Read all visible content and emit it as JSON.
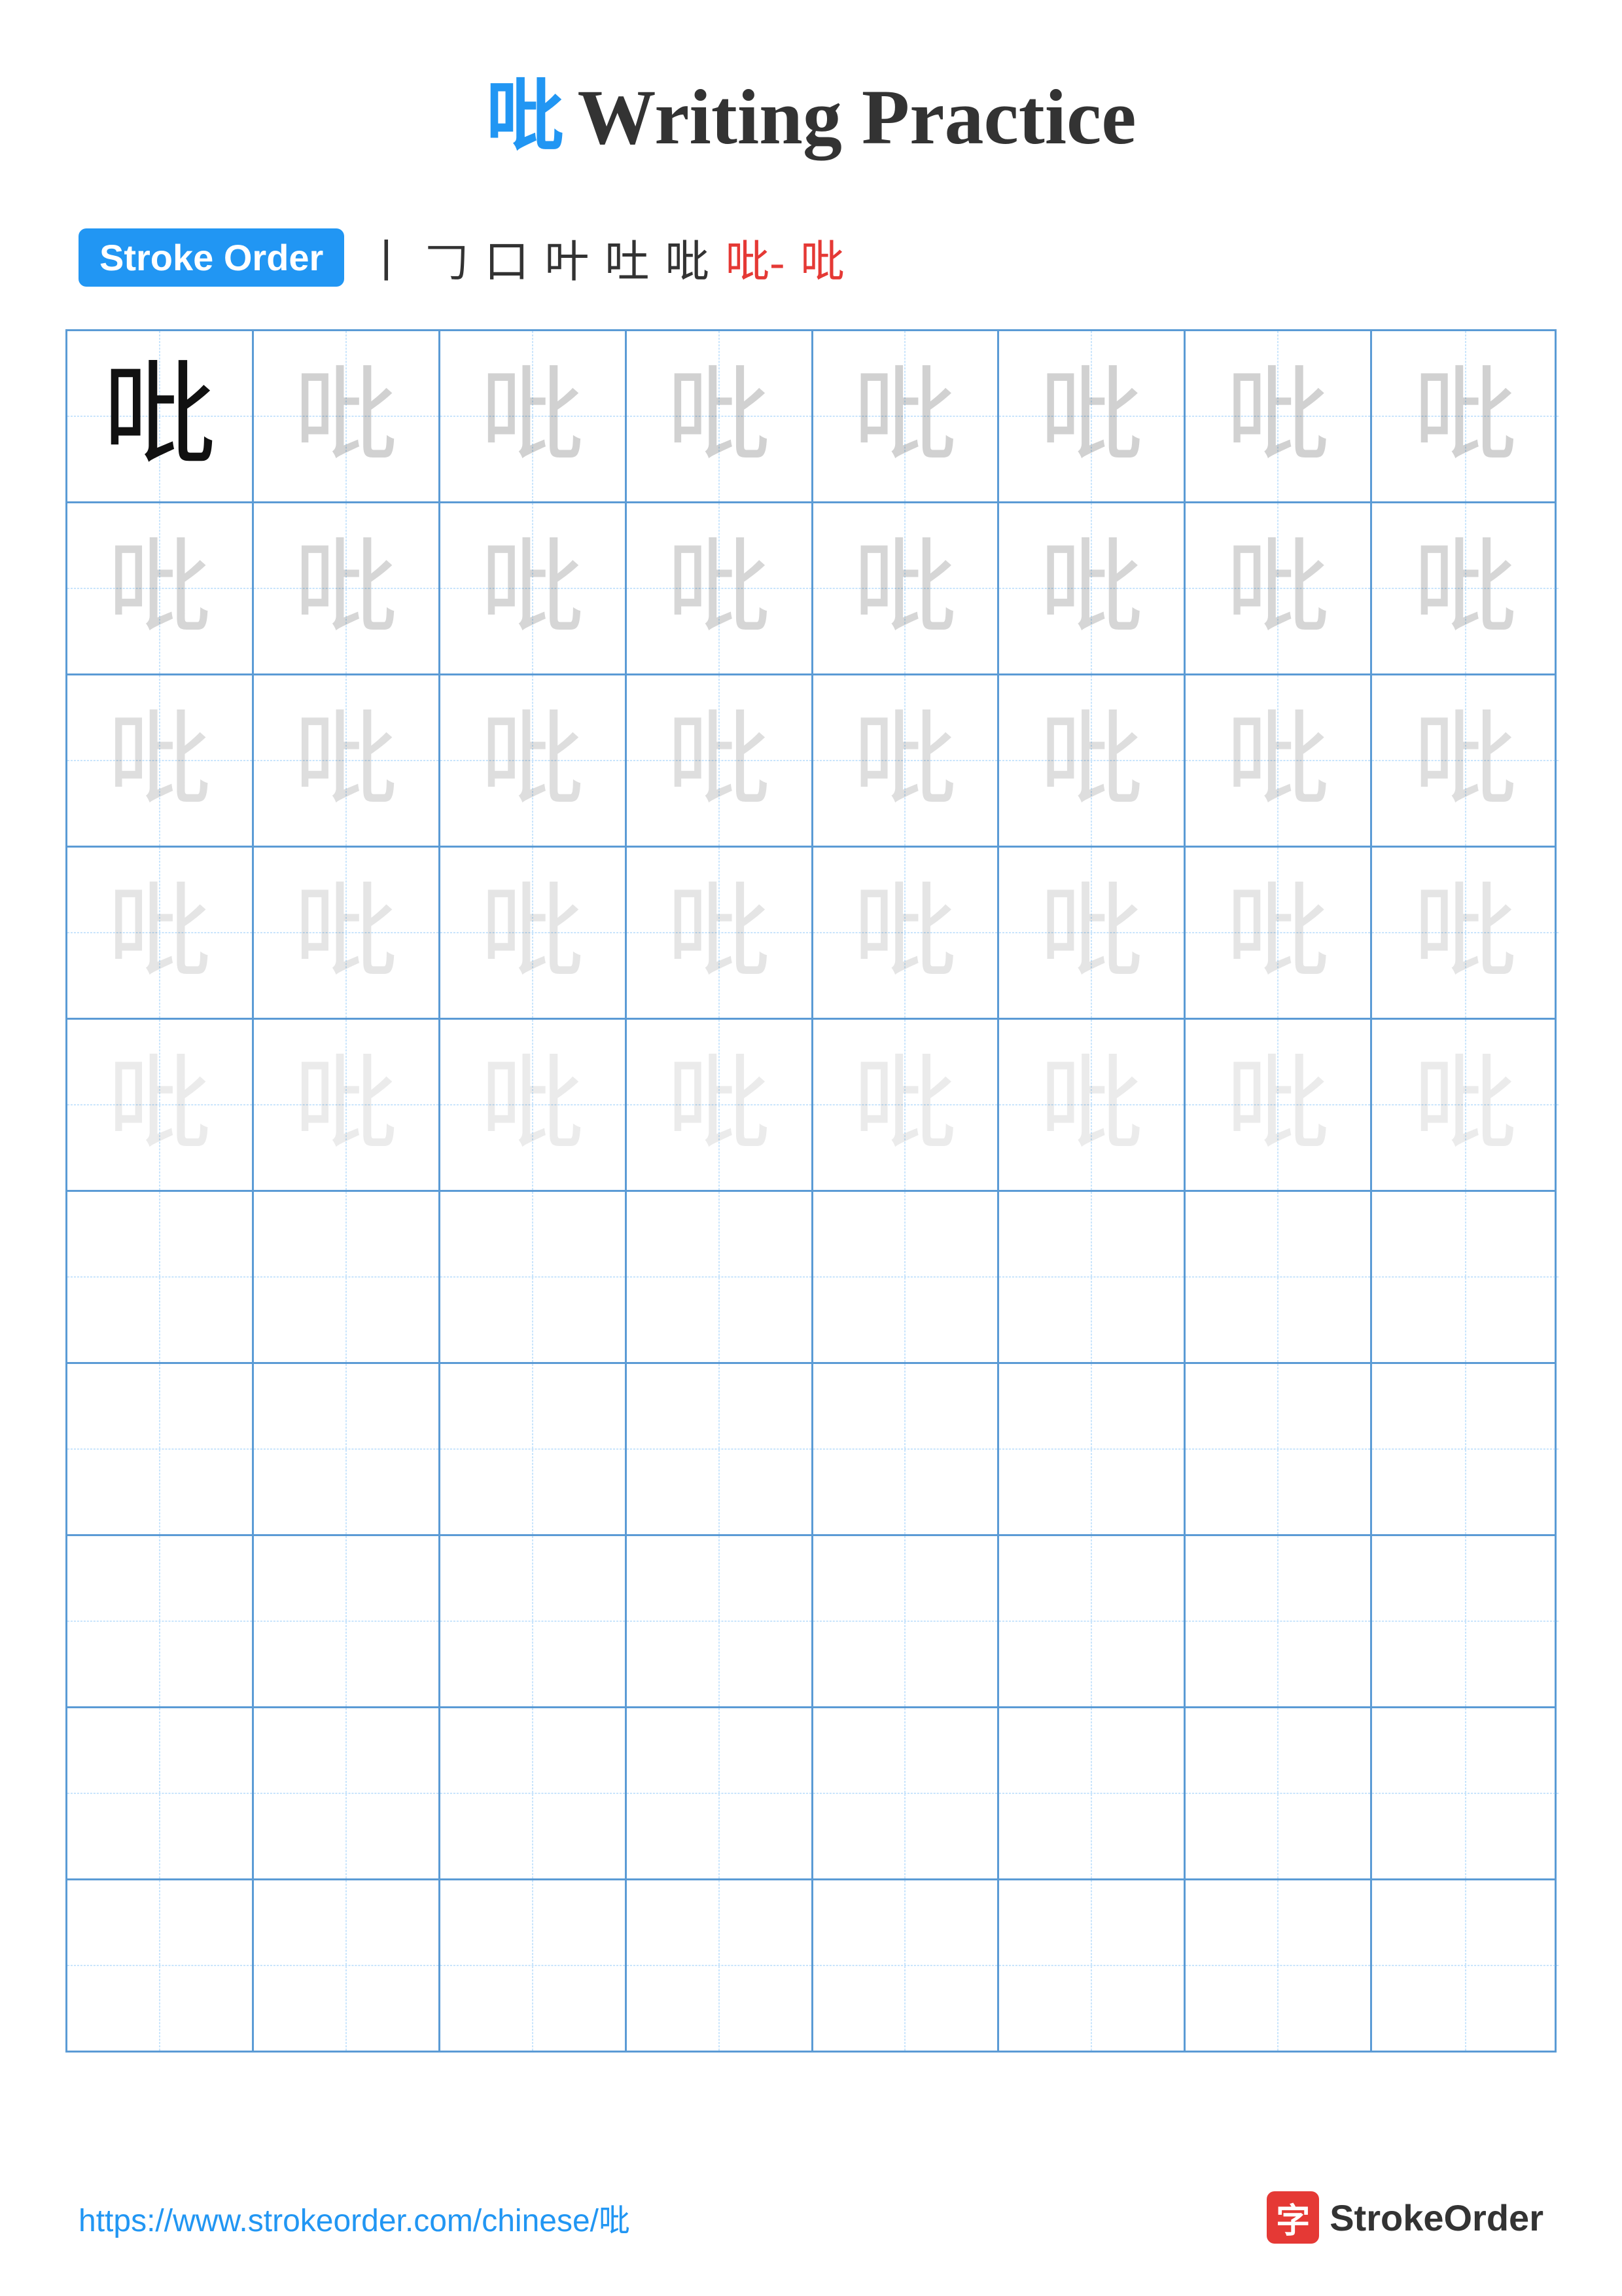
{
  "title": {
    "char": "吡",
    "text": "Writing Practice"
  },
  "stroke_order": {
    "badge": "Stroke Order",
    "steps": [
      "丨",
      "𠃌",
      "口",
      "叶",
      "吐",
      "吡",
      "吡⁻",
      "吡"
    ]
  },
  "grid": {
    "rows": 10,
    "cols": 8,
    "char": "吡"
  },
  "footer": {
    "url": "https://www.strokeorder.com/chinese/吡",
    "brand_char": "字",
    "brand_name": "StrokeOrder"
  }
}
